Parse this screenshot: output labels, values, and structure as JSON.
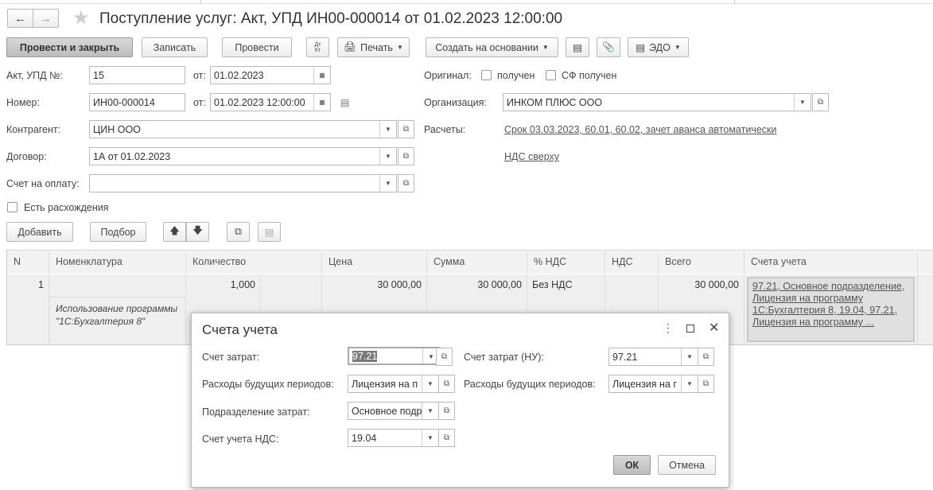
{
  "title": "Поступление услуг: Акт, УПД ИН00-000014 от 01.02.2023 12:00:00",
  "toolbar": {
    "post_close": "Провести и закрыть",
    "save": "Записать",
    "post": "Провести",
    "dt_kt_top": "Дт",
    "dt_kt_bottom": "Кт",
    "print": "Печать",
    "create_based": "Создать на основании",
    "edo": "ЭДО"
  },
  "form": {
    "act_label": "Акт, УПД №:",
    "act_value": "15",
    "from_label": "от:",
    "act_date": "01.02.2023",
    "number_label": "Номер:",
    "number_value": "ИН00-000014",
    "from_label2": "от:",
    "number_date": "01.02.2023 12:00:00",
    "contractor_label": "Контрагент:",
    "contractor_value": "ЦИН ООО",
    "contract_label": "Договор:",
    "contract_value": "1А от 01.02.2023",
    "invoice_label": "Счет на оплату:",
    "invoice_value": "",
    "discrepancy_label": "Есть расхождения",
    "original_label": "Оригинал:",
    "received_label": "получен",
    "sf_received_label": "СФ получен",
    "org_label": "Организация:",
    "org_value": "ИНКОМ ПЛЮС ООО",
    "settlements_label": "Расчеты:",
    "settlements_link": "Срок 03.03.2023, 60.01, 60.02, зачет аванса автоматически",
    "vat_link": "НДС сверху"
  },
  "table_toolbar": {
    "add": "Добавить",
    "pick": "Подбор"
  },
  "table": {
    "headers": [
      "N",
      "Номенклатура",
      "Количество",
      "Цена",
      "Сумма",
      "% НДС",
      "НДС",
      "Всего",
      "Счета учета"
    ],
    "rows": [
      {
        "n": "1",
        "item": "",
        "content": "Использование программы \"1С:Бухгалтерия 8\"",
        "qty": "1,000",
        "price": "30 000,00",
        "sum": "30 000,00",
        "vat_rate": "Без НДС",
        "vat": "",
        "total": "30 000,00",
        "accounts": "97.21, Основное подразделение, Лицензия на программу 1С:Бухгалтерия 8, 19.04, 97.21, Лицензия на программу ..."
      }
    ]
  },
  "dialog": {
    "title": "Счета учета",
    "cost_account_label": "Счет затрат:",
    "cost_account_value": "97.21",
    "cost_account_nu_label": "Счет затрат (НУ):",
    "cost_account_nu_value": "97.21",
    "deferred_label": "Расходы будущих периодов:",
    "deferred_value": "Лицензия на п",
    "deferred_nu_label": "Расходы будущих периодов:",
    "deferred_nu_value": "Лицензия на г",
    "dept_label": "Подразделение затрат:",
    "dept_value": "Основное подр",
    "vat_account_label": "Счет учета НДС:",
    "vat_account_value": "19.04",
    "ok": "ОК",
    "cancel": "Отмена"
  }
}
